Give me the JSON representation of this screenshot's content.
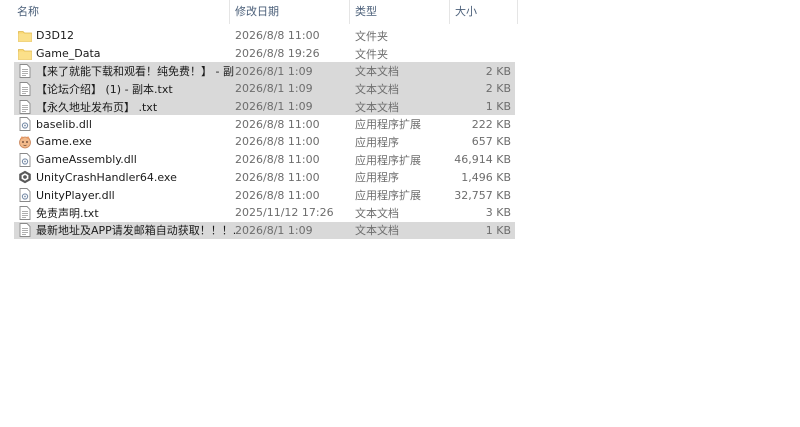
{
  "columns": {
    "name": "名称",
    "date": "修改日期",
    "type": "类型",
    "size": "大小",
    "sort_indicator": "^"
  },
  "files": [
    {
      "name": "D3D12",
      "date": "2026/8/8 11:00",
      "type": "文件夹",
      "size": "",
      "icon": "folder-icon",
      "selected": false
    },
    {
      "name": "Game_Data",
      "date": "2026/8/8 19:26",
      "type": "文件夹",
      "size": "",
      "icon": "folder-icon",
      "selected": false
    },
    {
      "name": "【来了就能下载和观看！纯免费！】 - 副...",
      "date": "2026/8/1 1:09",
      "type": "文本文档",
      "size": "2 KB",
      "icon": "text-file-icon",
      "selected": true
    },
    {
      "name": "【论坛介绍】 (1) - 副本.txt",
      "date": "2026/8/1 1:09",
      "type": "文本文档",
      "size": "2 KB",
      "icon": "text-file-icon",
      "selected": true
    },
    {
      "name": "【永久地址发布页】 .txt",
      "date": "2026/8/1 1:09",
      "type": "文本文档",
      "size": "1 KB",
      "icon": "text-file-icon",
      "selected": true
    },
    {
      "name": "baselib.dll",
      "date": "2026/8/8 11:00",
      "type": "应用程序扩展",
      "size": "222 KB",
      "icon": "dll-file-icon",
      "selected": false
    },
    {
      "name": "Game.exe",
      "date": "2026/8/8 11:00",
      "type": "应用程序",
      "size": "657 KB",
      "icon": "game-exe-icon",
      "selected": false
    },
    {
      "name": "GameAssembly.dll",
      "date": "2026/8/8 11:00",
      "type": "应用程序扩展",
      "size": "46,914 KB",
      "icon": "dll-file-icon",
      "selected": false
    },
    {
      "name": "UnityCrashHandler64.exe",
      "date": "2026/8/8 11:00",
      "type": "应用程序",
      "size": "1,496 KB",
      "icon": "unity-icon",
      "selected": false
    },
    {
      "name": "UnityPlayer.dll",
      "date": "2026/8/8 11:00",
      "type": "应用程序扩展",
      "size": "32,757 KB",
      "icon": "dll-file-icon",
      "selected": false
    },
    {
      "name": "免责声明.txt",
      "date": "2025/11/12 17:26",
      "type": "文本文档",
      "size": "3 KB",
      "icon": "text-file-icon",
      "selected": false
    },
    {
      "name": "最新地址及APP请发邮箱自动获取！！！...",
      "date": "2026/8/1 1:09",
      "type": "文本文档",
      "size": "1 KB",
      "icon": "text-file-icon",
      "selected": true
    }
  ],
  "colors": {
    "selection": "#d9d9d9",
    "folder": "#f8d775",
    "header_text": "#4c607a"
  }
}
